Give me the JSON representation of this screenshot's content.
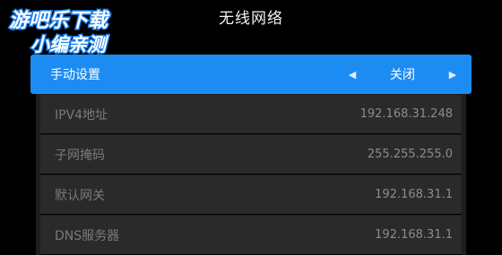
{
  "watermark": {
    "line1": "游吧乐下载",
    "line2": "小编亲测"
  },
  "title": "无线网络",
  "manual_setting": {
    "label": "手动设置",
    "value": "关闭",
    "left_icon": "triangle-left-icon",
    "right_icon": "triangle-right-icon"
  },
  "rows": [
    {
      "label": "IPV4地址",
      "value": "192.168.31.248"
    },
    {
      "label": "子网掩码",
      "value": "255.255.255.0"
    },
    {
      "label": "默认网关",
      "value": "192.168.31.1"
    },
    {
      "label": "DNS服务器",
      "value": "192.168.31.1"
    }
  ],
  "colors": {
    "accent": "#1d8cf2",
    "background": "#000000",
    "row": "#2a2a2a"
  }
}
